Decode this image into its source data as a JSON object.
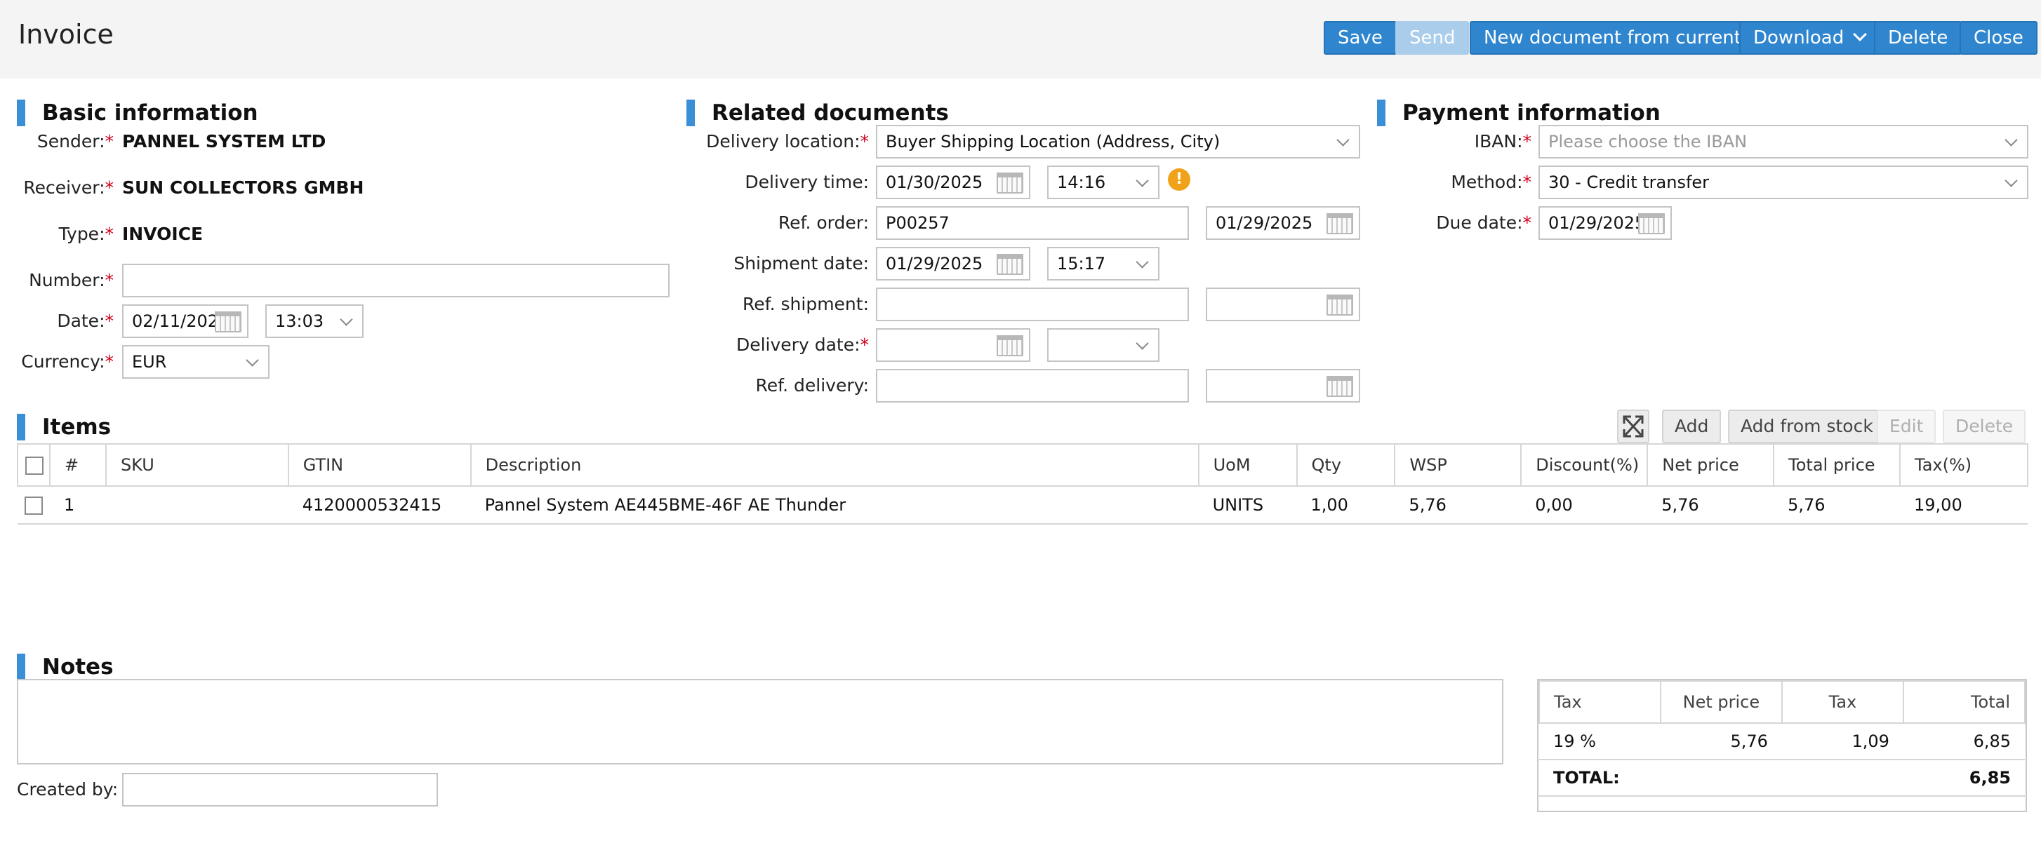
{
  "header": {
    "title": "Invoice",
    "buttons": {
      "save": "Save",
      "send": "Send",
      "new_document": "New document from current",
      "download": "Download",
      "delete": "Delete",
      "close": "Close"
    }
  },
  "basic_info": {
    "title": "Basic information",
    "sender_label": "Sender:",
    "sender": "PANNEL SYSTEM LTD",
    "receiver_label": "Receiver:",
    "receiver": "SUN COLLECTORS GMBH",
    "type_label": "Type:",
    "type": "INVOICE",
    "number_label": "Number:",
    "number": "",
    "date_label": "Date:",
    "date": "02/11/2025",
    "time": "13:03",
    "currency_label": "Currency:",
    "currency": "EUR"
  },
  "related": {
    "title": "Related documents",
    "delivery_location_label": "Delivery location:",
    "delivery_location": "Buyer Shipping Location (Address, City)",
    "delivery_time_label": "Delivery time:",
    "delivery_time_date": "01/30/2025",
    "delivery_time_time": "14:16",
    "ref_order_label": "Ref. order:",
    "ref_order": "P00257",
    "ref_order_date": "01/29/2025",
    "shipment_date_label": "Shipment date:",
    "shipment_date": "01/29/2025",
    "shipment_time": "15:17",
    "ref_shipment_label": "Ref. shipment:",
    "delivery_date_label": "Delivery date:",
    "ref_delivery_label": "Ref. delivery:"
  },
  "payment": {
    "title": "Payment information",
    "iban_label": "IBAN:",
    "iban_placeholder": "Please choose the IBAN",
    "method_label": "Method:",
    "method": "30 - Credit transfer",
    "due_date_label": "Due date:",
    "due_date": "01/29/2025"
  },
  "items": {
    "title": "Items",
    "buttons": {
      "add": "Add",
      "add_from_stock": "Add from stock",
      "edit": "Edit",
      "delete": "Delete"
    },
    "columns": [
      "#",
      "SKU",
      "GTIN",
      "Description",
      "UoM",
      "Qty",
      "WSP",
      "Discount(%)",
      "Net price",
      "Total price",
      "Tax(%)"
    ],
    "rows": [
      {
        "num": "1",
        "sku": "",
        "gtin": "4120000532415",
        "description": "Pannel System AE445BME-46F AE Thunder",
        "uom": "UNITS",
        "qty": "1,00",
        "wsp": "5,76",
        "discount": "0,00",
        "net_price": "5,76",
        "total_price": "5,76",
        "tax": "19,00"
      }
    ]
  },
  "notes": {
    "title": "Notes",
    "text": "",
    "created_by_label": "Created by:",
    "created_by": ""
  },
  "tax_summary": {
    "columns": [
      "Tax",
      "Net price",
      "Tax",
      "Total"
    ],
    "rows": [
      {
        "tax": "19 %",
        "net_price": "5,76",
        "tax_amount": "1,09",
        "total": "6,85"
      }
    ],
    "total_label": "TOTAL:",
    "total": "6,85"
  },
  "colors": {
    "primary_button": "#2f86cf",
    "disabled_button": "#a9cdeb",
    "section_accent": "#3b8fd6",
    "required": "#d0021b",
    "warning": "#f0a21a"
  }
}
